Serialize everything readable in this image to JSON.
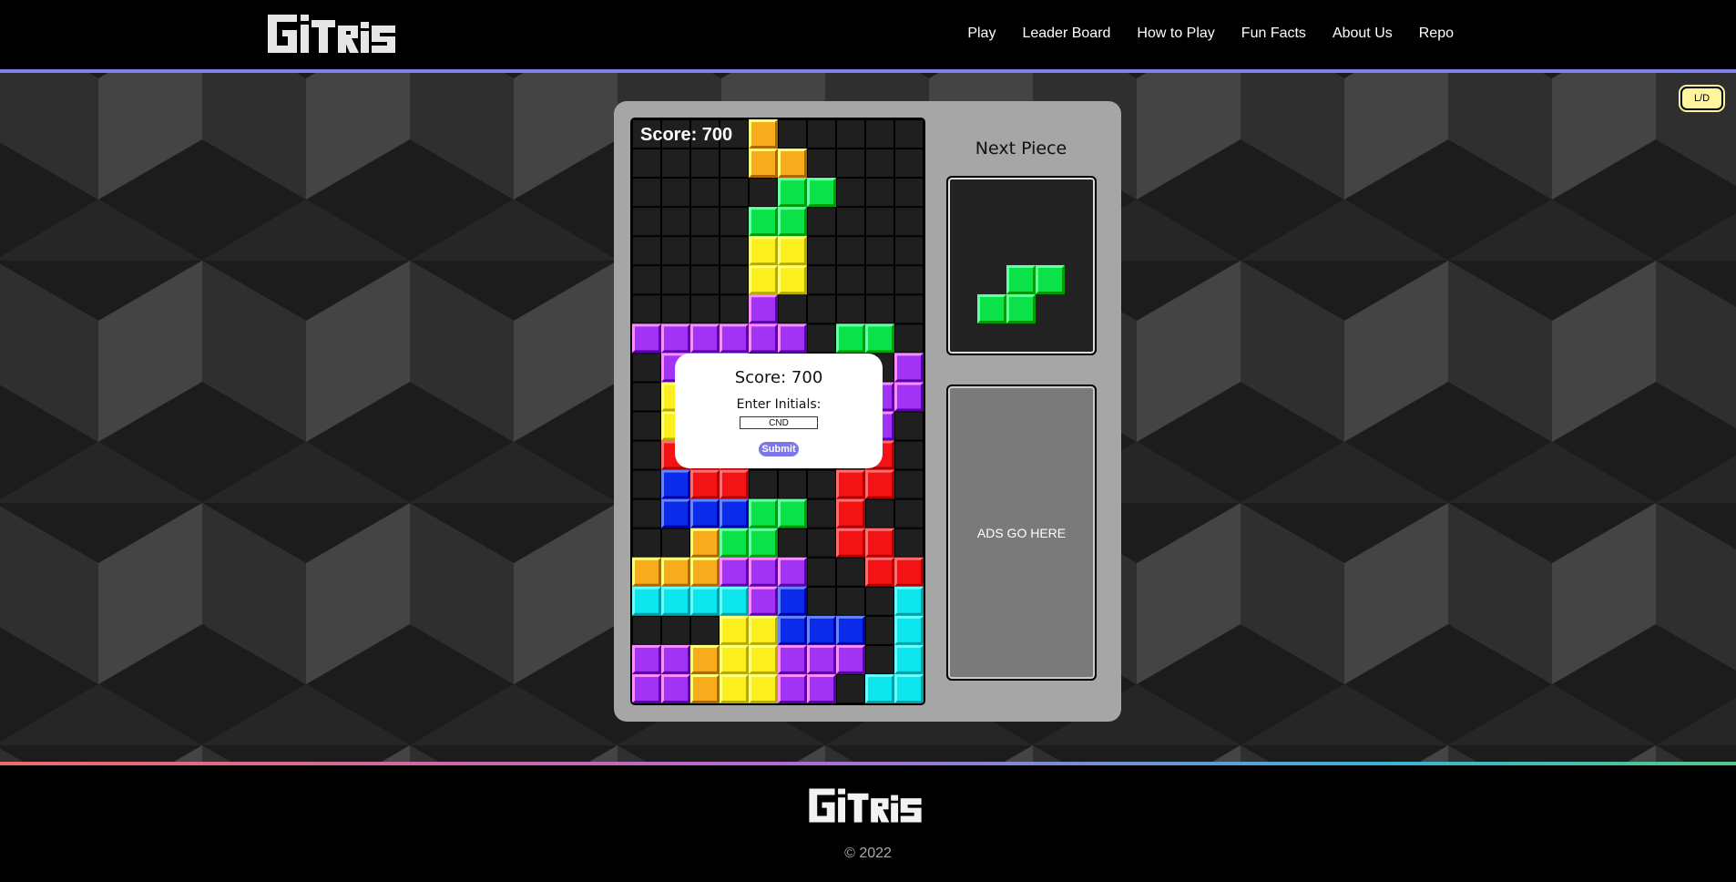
{
  "header": {
    "logo_text": "GiTRiS",
    "nav": [
      "Play",
      "Leader Board",
      "How to Play",
      "Fun Facts",
      "About Us",
      "Repo"
    ]
  },
  "theme_toggle": {
    "label": "L/D",
    "color": "#fff59d"
  },
  "game": {
    "score_label": "Score: 700",
    "board": {
      "columns": 10,
      "rows": 20,
      "legend": {
        "O": "#f7ad1e",
        "G": "#0be24a",
        "Y": "#fbf01e",
        "P": "#a033f4",
        "R": "#f31314",
        "B": "#0a2bea",
        "C": "#0ce6ec",
        ".": "#1f1f1f"
      },
      "grid": [
        "....O.....",
        "....OO....",
        ".....GG...",
        "....GG....",
        "....YY....",
        "....YY....",
        "....P.....",
        "PPPPPP.GG.",
        ".PPP.....P",
        ".YYR....PP",
        ".YYR....P.",
        ".RRR....R.",
        ".BRR...RR.",
        ".BBBGG.R..",
        "..OGG..RR.",
        "OOOPPP..RR",
        "CCCCPB...C",
        "...YYBBB.C",
        "PPOYYPPP.C",
        "PPOYYPP.CC"
      ]
    },
    "next_piece": {
      "title": "Next Piece",
      "shape": "S",
      "color": "#0be24a",
      "cells": [
        [
          1,
          0
        ],
        [
          2,
          0
        ],
        [
          0,
          1
        ],
        [
          1,
          1
        ]
      ]
    },
    "ads_text": "ADS GO HERE"
  },
  "modal": {
    "score": "Score: 700",
    "prompt": "Enter Initials:",
    "input_value": "CND",
    "submit_label": "Submit",
    "accent": "#7b77e8"
  },
  "footer": {
    "logo_text": "GiTRiS",
    "copyright": "© 2022"
  }
}
